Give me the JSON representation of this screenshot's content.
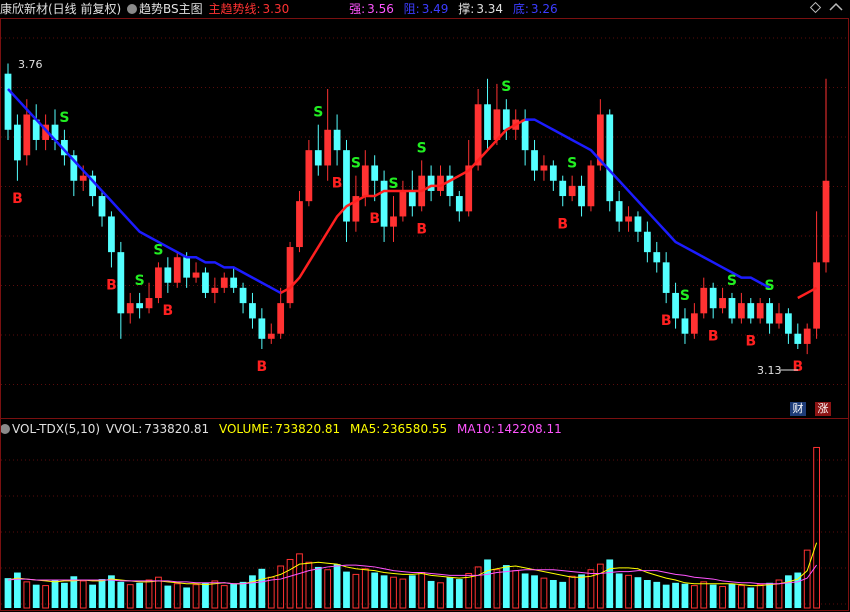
{
  "header": {
    "title": "康欣新材(日线 前复权)",
    "indicator": "趋势BS主图",
    "main_trend_label": "主趋势线:",
    "main_trend_value": "3.30",
    "strong_label": "强:",
    "strong_value": "3.56",
    "resist_label": "阻:",
    "resist_value": "3.49",
    "support_label": "撑:",
    "support_value": "3.34",
    "bottom_label": "底:",
    "bottom_value": "3.26"
  },
  "price_labels": {
    "high": "3.76",
    "low": "3.13"
  },
  "tags": {
    "finance": "财",
    "rise": "涨"
  },
  "volume_header": {
    "name": "VOL-TDX(5,10)",
    "vvol_label": "VVOL:",
    "vvol_value": "733820.81",
    "volume_label": "VOLUME:",
    "volume_value": "733820.81",
    "ma5_label": "MA5:",
    "ma5_value": "236580.55",
    "ma10_label": "MA10:",
    "ma10_value": "142208.11"
  },
  "colors": {
    "up": "#ff3232",
    "down": "#54ffff",
    "trend": "#1c1cff",
    "main_trend": "#ff2020",
    "buy": "#ff2020",
    "sell": "#22ee22",
    "ma5": "#ffff00",
    "ma10": "#ff55ff"
  },
  "chart_data": {
    "type": "candlestick",
    "y_range": [
      3.09,
      3.8
    ],
    "candles": [
      [
        3.73,
        3.62,
        3.75,
        3.6
      ],
      [
        3.63,
        3.56,
        3.65,
        3.52
      ],
      [
        3.57,
        3.65,
        3.68,
        3.55
      ],
      [
        3.64,
        3.6,
        3.67,
        3.58
      ],
      [
        3.6,
        3.63,
        3.65,
        3.58
      ],
      [
        3.63,
        3.6,
        3.66,
        3.58
      ],
      [
        3.6,
        3.57,
        3.62,
        3.55
      ],
      [
        3.57,
        3.52,
        3.58,
        3.49
      ],
      [
        3.52,
        3.53,
        3.55,
        3.5
      ],
      [
        3.53,
        3.49,
        3.54,
        3.47
      ],
      [
        3.49,
        3.45,
        3.5,
        3.43
      ],
      [
        3.45,
        3.38,
        3.46,
        3.35
      ],
      [
        3.38,
        3.26,
        3.4,
        3.21
      ],
      [
        3.26,
        3.28,
        3.3,
        3.24
      ],
      [
        3.28,
        3.27,
        3.3,
        3.25
      ],
      [
        3.27,
        3.29,
        3.32,
        3.26
      ],
      [
        3.29,
        3.35,
        3.36,
        3.28
      ],
      [
        3.35,
        3.32,
        3.37,
        3.3
      ],
      [
        3.32,
        3.37,
        3.38,
        3.31
      ],
      [
        3.37,
        3.33,
        3.38,
        3.31
      ],
      [
        3.33,
        3.34,
        3.36,
        3.32
      ],
      [
        3.34,
        3.3,
        3.35,
        3.29
      ],
      [
        3.3,
        3.31,
        3.33,
        3.28
      ],
      [
        3.31,
        3.33,
        3.34,
        3.3
      ],
      [
        3.33,
        3.31,
        3.35,
        3.3
      ],
      [
        3.31,
        3.28,
        3.32,
        3.26
      ],
      [
        3.28,
        3.25,
        3.3,
        3.23
      ],
      [
        3.25,
        3.21,
        3.27,
        3.19
      ],
      [
        3.21,
        3.22,
        3.24,
        3.2
      ],
      [
        3.22,
        3.28,
        3.31,
        3.21
      ],
      [
        3.28,
        3.39,
        3.4,
        3.27
      ],
      [
        3.39,
        3.48,
        3.5,
        3.38
      ],
      [
        3.48,
        3.58,
        3.6,
        3.47
      ],
      [
        3.58,
        3.55,
        3.63,
        3.53
      ],
      [
        3.55,
        3.62,
        3.7,
        3.52
      ],
      [
        3.62,
        3.58,
        3.65,
        3.55
      ],
      [
        3.58,
        3.44,
        3.6,
        3.4
      ],
      [
        3.44,
        3.49,
        3.53,
        3.42
      ],
      [
        3.49,
        3.55,
        3.58,
        3.47
      ],
      [
        3.55,
        3.52,
        3.57,
        3.48
      ],
      [
        3.52,
        3.43,
        3.54,
        3.4
      ],
      [
        3.43,
        3.45,
        3.49,
        3.4
      ],
      [
        3.45,
        3.5,
        3.52,
        3.44
      ],
      [
        3.5,
        3.47,
        3.54,
        3.45
      ],
      [
        3.47,
        3.53,
        3.56,
        3.46
      ],
      [
        3.53,
        3.5,
        3.55,
        3.48
      ],
      [
        3.5,
        3.53,
        3.55,
        3.49
      ],
      [
        3.53,
        3.49,
        3.55,
        3.47
      ],
      [
        3.49,
        3.46,
        3.5,
        3.44
      ],
      [
        3.46,
        3.55,
        3.6,
        3.45
      ],
      [
        3.55,
        3.67,
        3.7,
        3.54
      ],
      [
        3.67,
        3.6,
        3.72,
        3.58
      ],
      [
        3.6,
        3.66,
        3.71,
        3.59
      ],
      [
        3.66,
        3.62,
        3.68,
        3.6
      ],
      [
        3.62,
        3.64,
        3.66,
        3.6
      ],
      [
        3.64,
        3.58,
        3.66,
        3.55
      ],
      [
        3.58,
        3.54,
        3.6,
        3.52
      ],
      [
        3.54,
        3.55,
        3.57,
        3.52
      ],
      [
        3.55,
        3.52,
        3.56,
        3.5
      ],
      [
        3.52,
        3.49,
        3.53,
        3.47
      ],
      [
        3.49,
        3.51,
        3.53,
        3.48
      ],
      [
        3.51,
        3.47,
        3.53,
        3.45
      ],
      [
        3.47,
        3.55,
        3.56,
        3.46
      ],
      [
        3.55,
        3.65,
        3.68,
        3.54
      ],
      [
        3.65,
        3.48,
        3.66,
        3.46
      ],
      [
        3.48,
        3.44,
        3.5,
        3.42
      ],
      [
        3.44,
        3.45,
        3.47,
        3.42
      ],
      [
        3.45,
        3.42,
        3.46,
        3.4
      ],
      [
        3.42,
        3.38,
        3.44,
        3.36
      ],
      [
        3.38,
        3.36,
        3.4,
        3.34
      ],
      [
        3.36,
        3.3,
        3.38,
        3.28
      ],
      [
        3.3,
        3.25,
        3.32,
        3.23
      ],
      [
        3.25,
        3.22,
        3.27,
        3.2
      ],
      [
        3.22,
        3.26,
        3.28,
        3.21
      ],
      [
        3.26,
        3.31,
        3.33,
        3.25
      ],
      [
        3.31,
        3.27,
        3.32,
        3.25
      ],
      [
        3.27,
        3.29,
        3.31,
        3.26
      ],
      [
        3.29,
        3.25,
        3.3,
        3.24
      ],
      [
        3.25,
        3.28,
        3.3,
        3.24
      ],
      [
        3.28,
        3.25,
        3.29,
        3.24
      ],
      [
        3.25,
        3.28,
        3.29,
        3.24
      ],
      [
        3.28,
        3.24,
        3.29,
        3.22
      ],
      [
        3.24,
        3.26,
        3.28,
        3.23
      ],
      [
        3.26,
        3.22,
        3.27,
        3.2
      ],
      [
        3.22,
        3.2,
        3.24,
        3.19
      ],
      [
        3.2,
        3.23,
        3.24,
        3.18
      ],
      [
        3.23,
        3.36,
        3.46,
        3.21
      ],
      [
        3.36,
        3.52,
        3.72,
        3.34
      ]
    ],
    "volume": [
      32,
      38,
      28,
      25,
      24,
      30,
      27,
      34,
      29,
      25,
      31,
      35,
      28,
      25,
      27,
      30,
      33,
      24,
      26,
      22,
      25,
      27,
      29,
      24,
      26,
      28,
      35,
      42,
      33,
      45,
      52,
      58,
      49,
      44,
      41,
      47,
      39,
      36,
      42,
      38,
      35,
      33,
      31,
      35,
      38,
      29,
      27,
      33,
      31,
      37,
      44,
      52,
      41,
      46,
      40,
      37,
      35,
      32,
      30,
      28,
      34,
      36,
      41,
      47,
      52,
      37,
      35,
      33,
      30,
      28,
      25,
      27,
      26,
      24,
      28,
      25,
      23,
      26,
      24,
      22,
      25,
      27,
      30,
      35,
      38,
      62,
      172
    ],
    "ma5": [
      30,
      32,
      31,
      30,
      29,
      28,
      29,
      29,
      30,
      29,
      29,
      31,
      30,
      29,
      28,
      28,
      29,
      28,
      27,
      26,
      26,
      25,
      26,
      27,
      26,
      26,
      28,
      31,
      33,
      36,
      41,
      47,
      48,
      49,
      48,
      47,
      44,
      42,
      41,
      40,
      38,
      37,
      36,
      36,
      37,
      35,
      34,
      33,
      32,
      33,
      35,
      40,
      42,
      44,
      45,
      43,
      41,
      39,
      37,
      35,
      33,
      33,
      34,
      37,
      42,
      43,
      43,
      42,
      38,
      35,
      32,
      30,
      27,
      26,
      26,
      26,
      26,
      26,
      25,
      24,
      24,
      25,
      26,
      28,
      31,
      40,
      70
    ],
    "ma10": [
      30,
      31,
      31,
      30,
      30,
      30,
      30,
      30,
      30,
      30,
      30,
      30,
      29,
      29,
      29,
      29,
      29,
      29,
      28,
      28,
      27,
      27,
      27,
      27,
      26,
      26,
      27,
      28,
      30,
      31,
      34,
      37,
      40,
      42,
      44,
      45,
      46,
      46,
      45,
      44,
      42,
      40,
      39,
      38,
      38,
      37,
      36,
      35,
      35,
      35,
      35,
      36,
      38,
      39,
      40,
      41,
      41,
      41,
      41,
      40,
      39,
      38,
      37,
      37,
      38,
      39,
      39,
      40,
      40,
      40,
      38,
      36,
      35,
      33,
      32,
      31,
      29,
      28,
      27,
      27,
      26,
      26,
      26,
      27,
      28,
      32,
      46
    ],
    "trend_line": [
      3.7,
      3.68,
      3.66,
      3.64,
      3.62,
      3.6,
      3.58,
      3.56,
      3.54,
      3.52,
      3.5,
      3.48,
      3.46,
      3.44,
      3.42,
      3.41,
      3.4,
      3.39,
      3.38,
      3.37,
      3.37,
      3.36,
      3.36,
      3.35,
      3.35,
      3.34,
      3.33,
      3.32,
      3.31,
      3.3
    ],
    "main_trend_line": [
      [
        29,
        3.3
      ],
      [
        30,
        3.31
      ],
      [
        31,
        3.33
      ],
      [
        32,
        3.36
      ],
      [
        33,
        3.39
      ],
      [
        34,
        3.42
      ],
      [
        35,
        3.45
      ],
      [
        36,
        3.47
      ],
      [
        37,
        3.48
      ],
      [
        38,
        3.49
      ],
      [
        39,
        3.49
      ],
      [
        40,
        3.5
      ],
      [
        41,
        3.5
      ],
      [
        42,
        3.5
      ],
      [
        43,
        3.5
      ],
      [
        44,
        3.5
      ],
      [
        45,
        3.51
      ],
      [
        46,
        3.51
      ],
      [
        47,
        3.52
      ],
      [
        48,
        3.53
      ],
      [
        49,
        3.54
      ],
      [
        50,
        3.56
      ],
      [
        51,
        3.58
      ],
      [
        52,
        3.6
      ],
      [
        53,
        3.62
      ],
      [
        54,
        3.63
      ],
      [
        55,
        3.64
      ]
    ],
    "trend_line_2": [
      [
        55,
        3.64
      ],
      [
        56,
        3.64
      ],
      [
        57,
        3.63
      ],
      [
        58,
        3.62
      ],
      [
        59,
        3.61
      ],
      [
        60,
        3.6
      ],
      [
        61,
        3.59
      ],
      [
        62,
        3.58
      ],
      [
        63,
        3.56
      ],
      [
        64,
        3.54
      ],
      [
        65,
        3.52
      ],
      [
        66,
        3.5
      ],
      [
        67,
        3.48
      ],
      [
        68,
        3.46
      ],
      [
        69,
        3.44
      ],
      [
        70,
        3.42
      ],
      [
        71,
        3.4
      ],
      [
        72,
        3.39
      ],
      [
        73,
        3.38
      ],
      [
        74,
        3.37
      ],
      [
        75,
        3.36
      ],
      [
        76,
        3.35
      ],
      [
        77,
        3.34
      ],
      [
        78,
        3.33
      ],
      [
        79,
        3.33
      ],
      [
        80,
        3.32
      ],
      [
        81,
        3.31
      ]
    ],
    "main_trend_line_2": [
      [
        84,
        3.29
      ],
      [
        85,
        3.3
      ],
      [
        86,
        3.31
      ]
    ],
    "signals": [
      {
        "i": 6,
        "type": "S"
      },
      {
        "i": 14,
        "type": "S"
      },
      {
        "i": 16,
        "type": "S"
      },
      {
        "i": 1,
        "type": "B"
      },
      {
        "i": 11,
        "type": "B"
      },
      {
        "i": 17,
        "type": "B"
      },
      {
        "i": 27,
        "type": "B"
      },
      {
        "i": 33,
        "type": "S"
      },
      {
        "i": 37,
        "type": "S"
      },
      {
        "i": 41,
        "type": "S"
      },
      {
        "i": 44,
        "type": "S"
      },
      {
        "i": 35,
        "type": "B"
      },
      {
        "i": 39,
        "type": "B"
      },
      {
        "i": 44,
        "type": "B"
      },
      {
        "i": 53,
        "type": "S"
      },
      {
        "i": 60,
        "type": "S"
      },
      {
        "i": 59,
        "type": "B"
      },
      {
        "i": 72,
        "type": "S"
      },
      {
        "i": 77,
        "type": "S"
      },
      {
        "i": 81,
        "type": "S"
      },
      {
        "i": 70,
        "type": "B"
      },
      {
        "i": 75,
        "type": "B"
      },
      {
        "i": 79,
        "type": "B"
      },
      {
        "i": 84,
        "type": "B"
      }
    ]
  }
}
